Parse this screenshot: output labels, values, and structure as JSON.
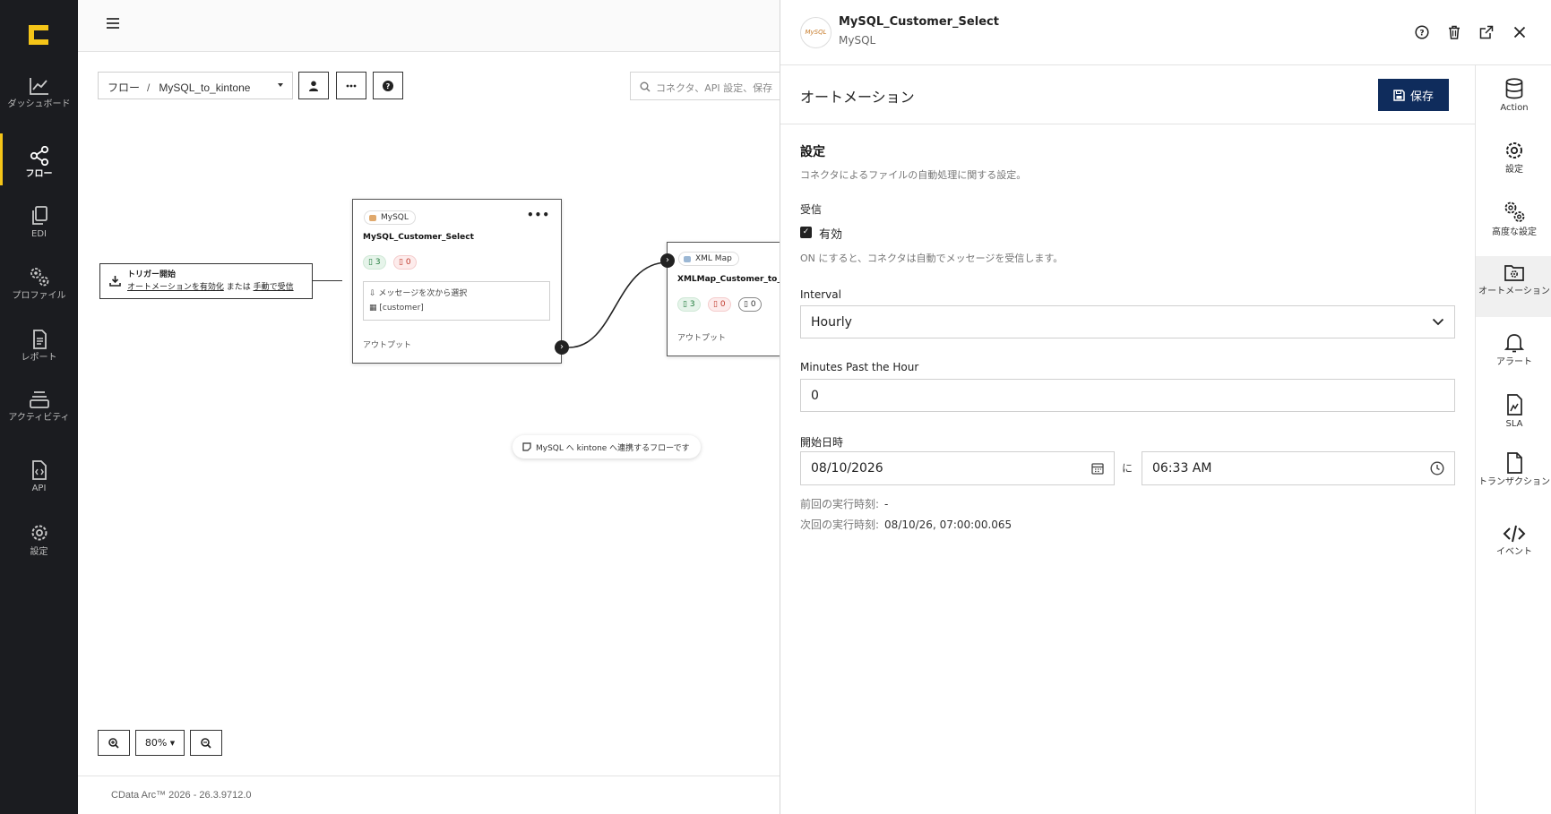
{
  "leftnav": {
    "items": [
      {
        "label": "ダッシュボード",
        "icon": "chart-line-icon"
      },
      {
        "label": "フロー",
        "icon": "share-nodes-icon"
      },
      {
        "label": "EDI",
        "icon": "copy-document-icon"
      },
      {
        "label": "プロファイル",
        "icon": "gears-icon"
      },
      {
        "label": "レポート",
        "icon": "report-document-icon"
      },
      {
        "label": "アクティビティ",
        "icon": "layers-icon"
      },
      {
        "label": "API",
        "icon": "api-file-icon"
      },
      {
        "label": "設定",
        "icon": "gear-icon"
      }
    ],
    "active_index": 1,
    "accent": "#f5c518"
  },
  "canvas": {
    "breadcrumb": {
      "root": "フロー",
      "separator": "/",
      "current": "MySQL_to_kintone"
    },
    "search_placeholder": "コネクタ、API 設定、保存",
    "trigger": {
      "title": "トリガー開始",
      "link1": "オートメーションを有効化",
      "middle": "または",
      "link2": "手動で受信"
    },
    "node1": {
      "type": "MySQL",
      "name": "MySQL_Customer_Select",
      "badge_green": "3",
      "badge_red": "0",
      "msg_title": "メッセージを次から選択",
      "msg_value": "[customer]",
      "output": "アウトプット"
    },
    "node2": {
      "type": "XML Map",
      "name": "XMLMap_Customer_to_C",
      "badge_green": "3",
      "badge_red": "0",
      "badge_black": "0",
      "output": "アウトプット"
    },
    "note": "MySQL へ kintone へ連携するフローです",
    "zoom": "80%",
    "footer": "CData Arc™ 2026 - 26.3.9712.0"
  },
  "panel": {
    "title": "MySQL_Customer_Select",
    "subtitle": "MySQL",
    "avatar_text": "MySQL",
    "section_title": "オートメーション",
    "save_label": "保存",
    "settings_title": "設定",
    "settings_desc": "コネクタによるファイルの自動処理に関する設定。",
    "receive_label": "受信",
    "enabled_label": "有効",
    "enabled_desc": "ON にすると、コネクタは自動でメッセージを受信します。",
    "interval_label": "Interval",
    "interval_value": "Hourly",
    "minutes_label": "Minutes Past the Hour",
    "minutes_value": "0",
    "start_label": "開始日時",
    "start_date": "08/10/2026",
    "between": "に",
    "start_time": "06:33 AM",
    "last_run_label": "前回の実行時刻:",
    "last_run_value": "-",
    "next_run_label": "次回の実行時刻:",
    "next_run_value": "08/10/26, 07:00:00.065"
  },
  "rightnav": {
    "items": [
      {
        "label": "Action",
        "icon": "database-icon"
      },
      {
        "label": "設定",
        "icon": "gear-icon"
      },
      {
        "label": "高度な設定",
        "icon": "gears-icon"
      },
      {
        "label": "オートメーション",
        "icon": "folder-gear-icon"
      },
      {
        "label": "アラート",
        "icon": "bell-icon"
      },
      {
        "label": "SLA",
        "icon": "sla-file-icon"
      },
      {
        "label": "トランザクション",
        "icon": "file-icon"
      },
      {
        "label": "イベント",
        "icon": "code-icon"
      }
    ],
    "active_index": 3
  }
}
